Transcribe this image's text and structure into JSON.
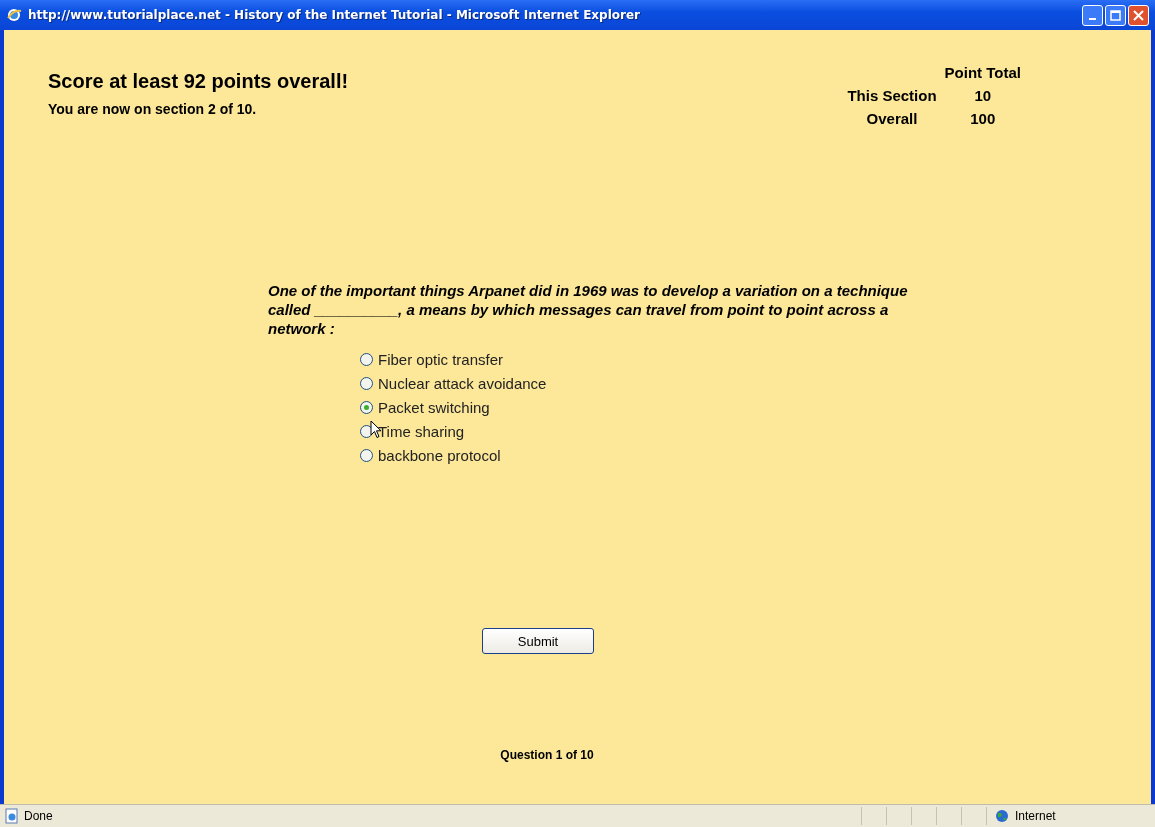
{
  "window": {
    "title": "http://www.tutorialplace.net - History of the Internet Tutorial - Microsoft Internet Explorer"
  },
  "heading": "Score at least 92 points overall!",
  "progress": "You are now on section 2 of 10.",
  "point_total": {
    "header": "Point Total",
    "rows": [
      {
        "label": "This Section",
        "value": "10"
      },
      {
        "label": "Overall",
        "value": "100"
      }
    ]
  },
  "question": "One of the important things Arpanet did in 1969 was to develop a variation on a technique called __________, a means by which messages can travel from point to point across a network :",
  "options": [
    {
      "label": "Fiber optic transfer",
      "selected": false
    },
    {
      "label": "Nuclear attack avoidance",
      "selected": false
    },
    {
      "label": "Packet switching",
      "selected": true
    },
    {
      "label": "Time sharing",
      "selected": false
    },
    {
      "label": "backbone protocol",
      "selected": false
    }
  ],
  "submit": "Submit",
  "footer": "Question 1 of 10",
  "status_bar": {
    "status": "Done",
    "zone": "Internet"
  }
}
